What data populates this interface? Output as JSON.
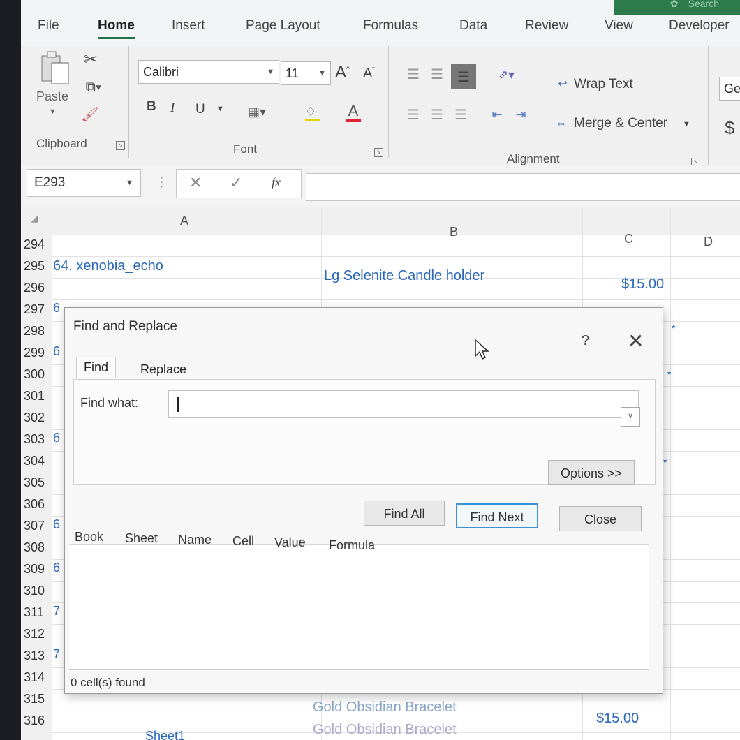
{
  "search": {
    "label": "Search",
    "icon": "lightbulb-icon"
  },
  "ribbon_tabs": [
    "File",
    "Home",
    "Insert",
    "Page Layout",
    "Formulas",
    "Data",
    "Review",
    "View",
    "Developer"
  ],
  "ribbon": {
    "clipboard": {
      "paste_label": "Paste",
      "group_label": "Clipboard"
    },
    "font": {
      "name": "Calibri",
      "size": "11",
      "group_label": "Font",
      "bold": "B",
      "italic": "I",
      "underline": "U"
    },
    "alignment": {
      "wrap_text": "Wrap Text",
      "merge_center": "Merge & Center",
      "group_label": "Alignment"
    },
    "number": {
      "format_partial": "Ge",
      "currency_symbol": "$"
    }
  },
  "name_box": "E293",
  "formula_symbol": "fx",
  "columns": [
    "A",
    "B",
    "C",
    "D"
  ],
  "rows": [
    "294",
    "295",
    "296",
    "297",
    "298",
    "299",
    "300",
    "301",
    "302",
    "303",
    "304",
    "305",
    "306",
    "307",
    "308",
    "309",
    "310",
    "311",
    "312",
    "313",
    "314",
    "315",
    "316"
  ],
  "cells": {
    "a295": "64. xenobia_echo",
    "b295": "Lg Selenite Candle holder",
    "c295": "$15.00",
    "b316": "Gold Obsidian Bracelet",
    "c316": "$15.00",
    "b317": "Gold Obsidian Bracelet"
  },
  "partial_a": {
    "297": "6",
    "299": "6",
    "303": "6",
    "307": "6",
    "309": "6",
    "311": "7",
    "313": "7"
  },
  "sheet_tab": "Sheet1",
  "dialog": {
    "title": "Find and Replace",
    "help": "?",
    "tabs": {
      "find": "Find",
      "replace": "Replace"
    },
    "find_what_label": "Find what:",
    "find_what_value": "",
    "options_button": "Options >>",
    "find_all_button": "Find All",
    "find_next_button": "Find Next",
    "close_button": "Close",
    "result_headers": [
      "Book",
      "Sheet",
      "Name",
      "Cell",
      "Value",
      "Formula"
    ],
    "status": "0 cell(s) found"
  }
}
